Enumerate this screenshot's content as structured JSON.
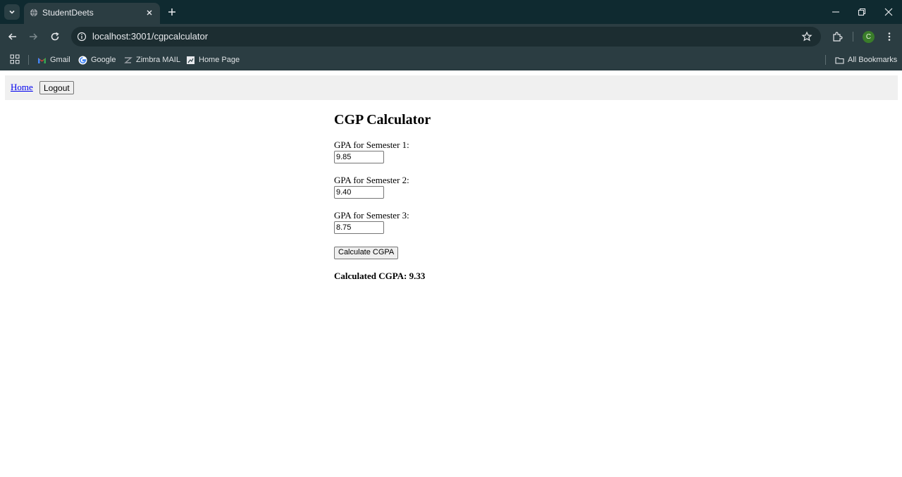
{
  "browser": {
    "tab": {
      "title": "StudentDeets"
    },
    "address_bar": {
      "url": "localhost:3001/cgpcalculator"
    },
    "profile_initial": "C",
    "bookmarks": [
      {
        "label": "Gmail",
        "icon": "gmail-icon"
      },
      {
        "label": "Google",
        "icon": "google-icon"
      },
      {
        "label": "Zimbra MAIL",
        "icon": "zimbra-icon"
      },
      {
        "label": "Home Page",
        "icon": "home-page-icon"
      }
    ],
    "all_bookmarks_label": "All Bookmarks",
    "colors": {
      "tabstrip": "#0f2a30",
      "toolbar": "#2b3d42",
      "profile": "#3a7d2a"
    }
  },
  "page": {
    "nav": {
      "home_label": "Home",
      "logout_label": "Logout"
    },
    "title": "CGP Calculator",
    "fields": [
      {
        "label": "GPA for Semester 1:",
        "value": "9.85"
      },
      {
        "label": "GPA for Semester 2:",
        "value": "9.40"
      },
      {
        "label": "GPA for Semester 3:",
        "value": "8.75"
      }
    ],
    "calculate_label": "Calculate CGPA",
    "result_text": "Calculated CGPA: 9.33"
  }
}
